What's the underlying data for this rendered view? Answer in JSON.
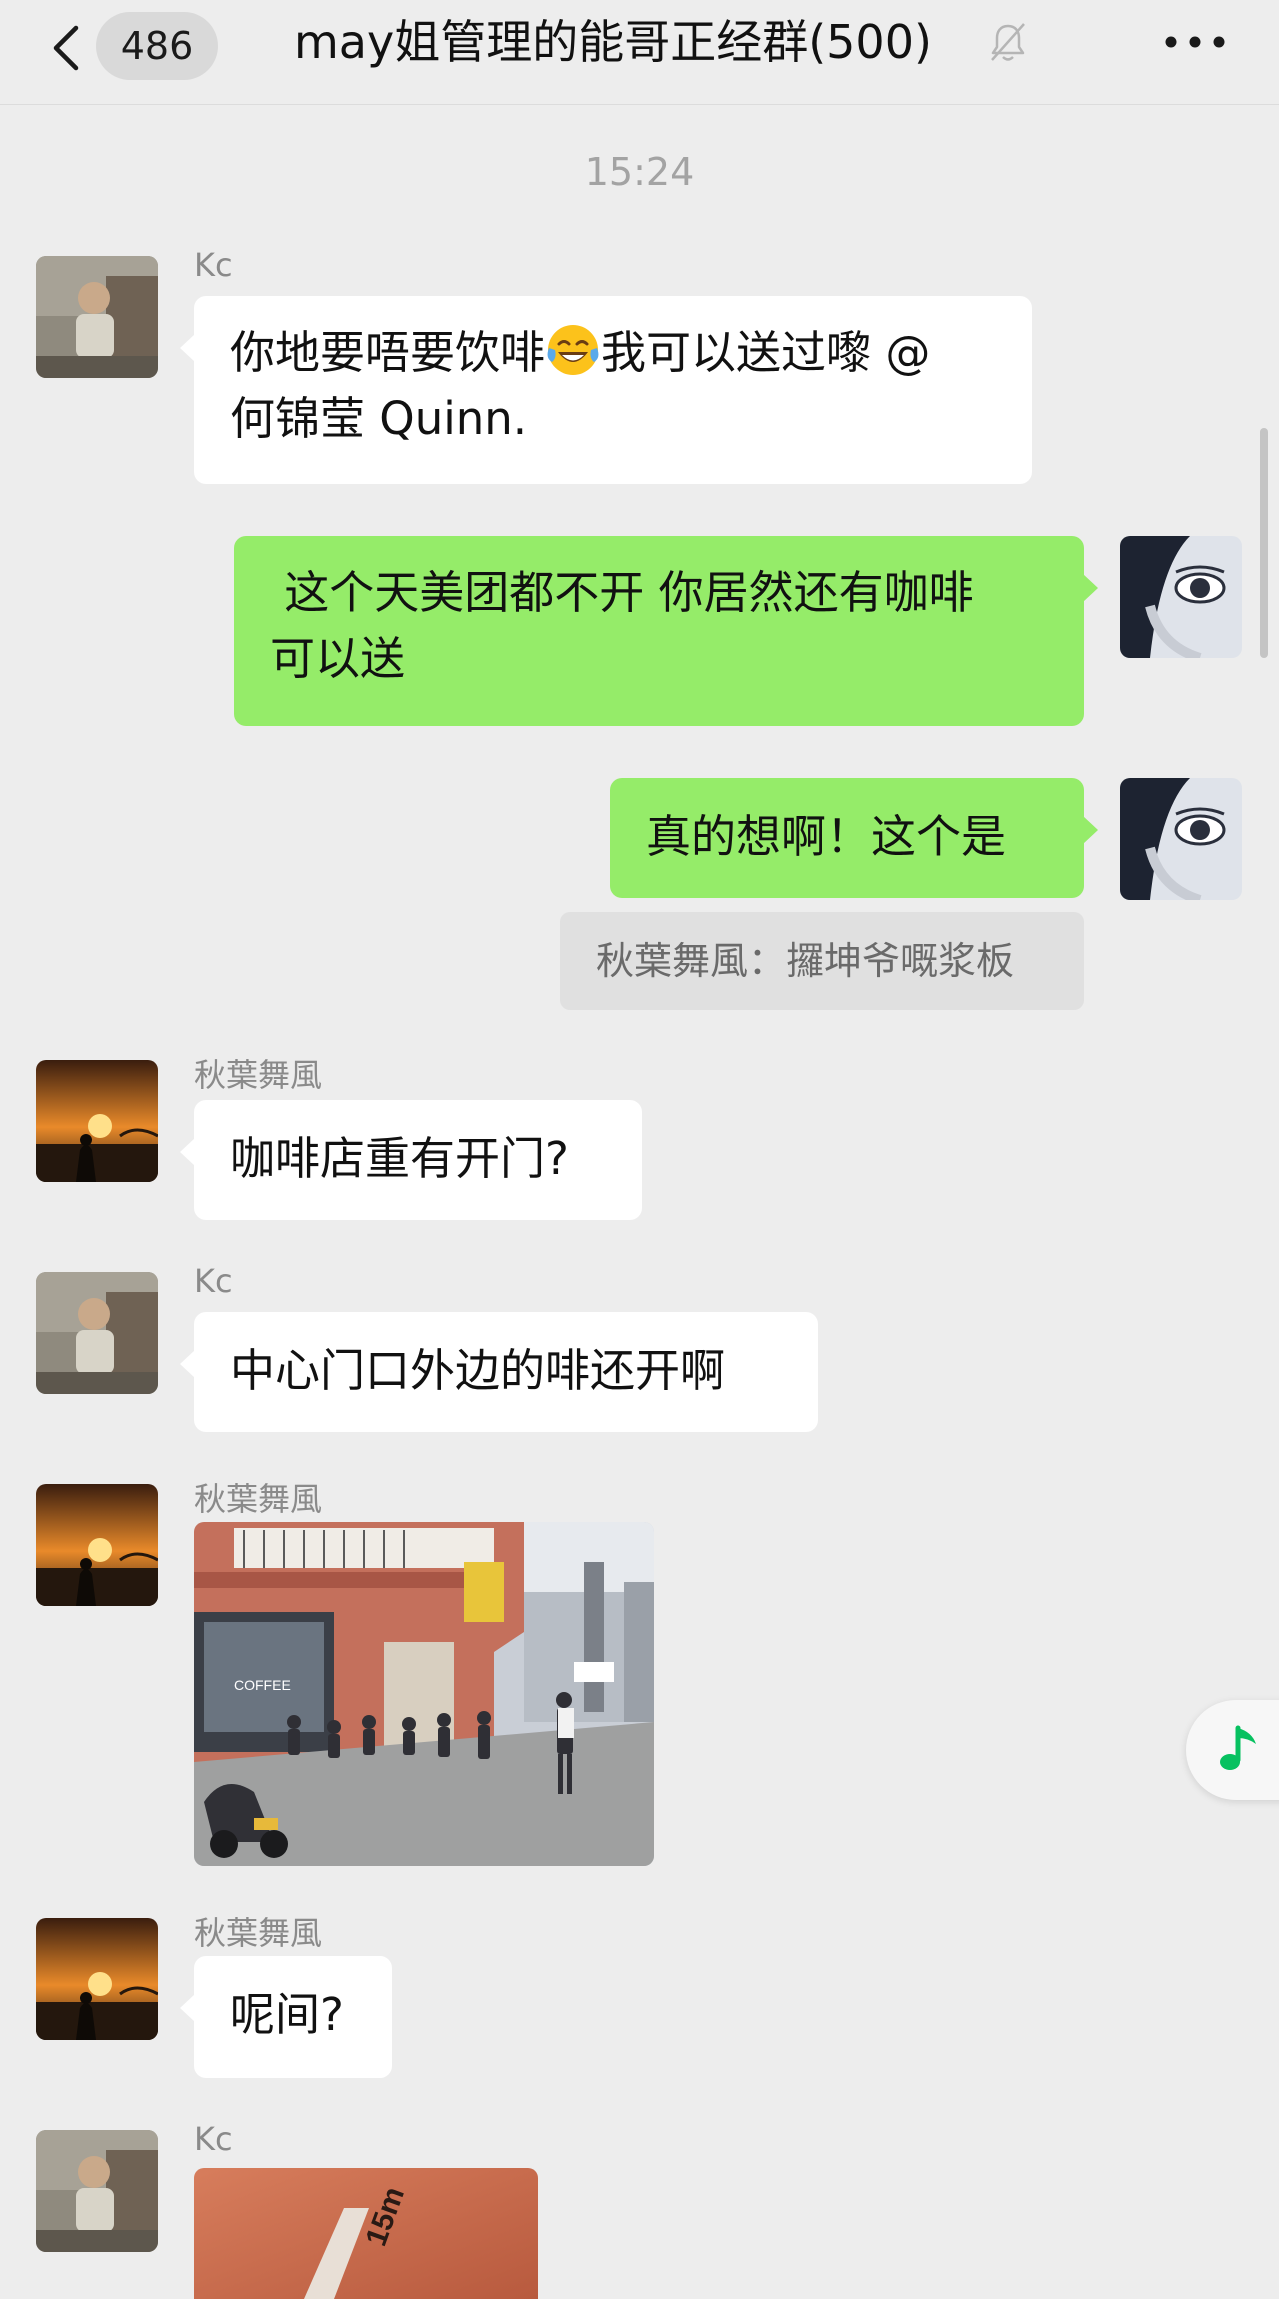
{
  "header": {
    "unread_count": "486",
    "title": "may姐管理的能哥正经群(500)",
    "icons": {
      "back": "chevron-left-icon",
      "mute": "bell-muted-icon",
      "more": "more-dots-icon"
    }
  },
  "timestamp": "15:24",
  "messages": [
    {
      "sender": "Kc",
      "side": "left",
      "text_1": "你地要唔要饮啡",
      "emoji": "laughing-tears-emoji",
      "text_2": "我可以送过嚟 @",
      "line_2": "何锦莹 Quinn."
    },
    {
      "side": "right",
      "line_1": " 这个天美团都不开 你居然还有咖啡",
      "line_2": "可以送"
    },
    {
      "side": "right",
      "text": "真的想啊！这个是",
      "quote": "秋葉舞風：攞坤爷嘅浆板"
    },
    {
      "sender": "秋葉舞風",
      "side": "left",
      "text": "咖啡店重有开门?"
    },
    {
      "sender": "Kc",
      "side": "left",
      "text": "中心门口外边的啡还开啊"
    },
    {
      "sender": "秋葉舞風",
      "side": "left",
      "type": "image",
      "image_text": "COFFEE"
    },
    {
      "sender": "秋葉舞風",
      "side": "left",
      "text": "呢间?"
    },
    {
      "sender": "Kc",
      "side": "left",
      "type": "image",
      "image_text": "15m"
    }
  ],
  "floating": {
    "icon": "music-note-icon",
    "color": "#07c160"
  },
  "colors": {
    "background": "#ededed",
    "bubble_self": "#95ec69",
    "bubble_other": "#ffffff"
  }
}
